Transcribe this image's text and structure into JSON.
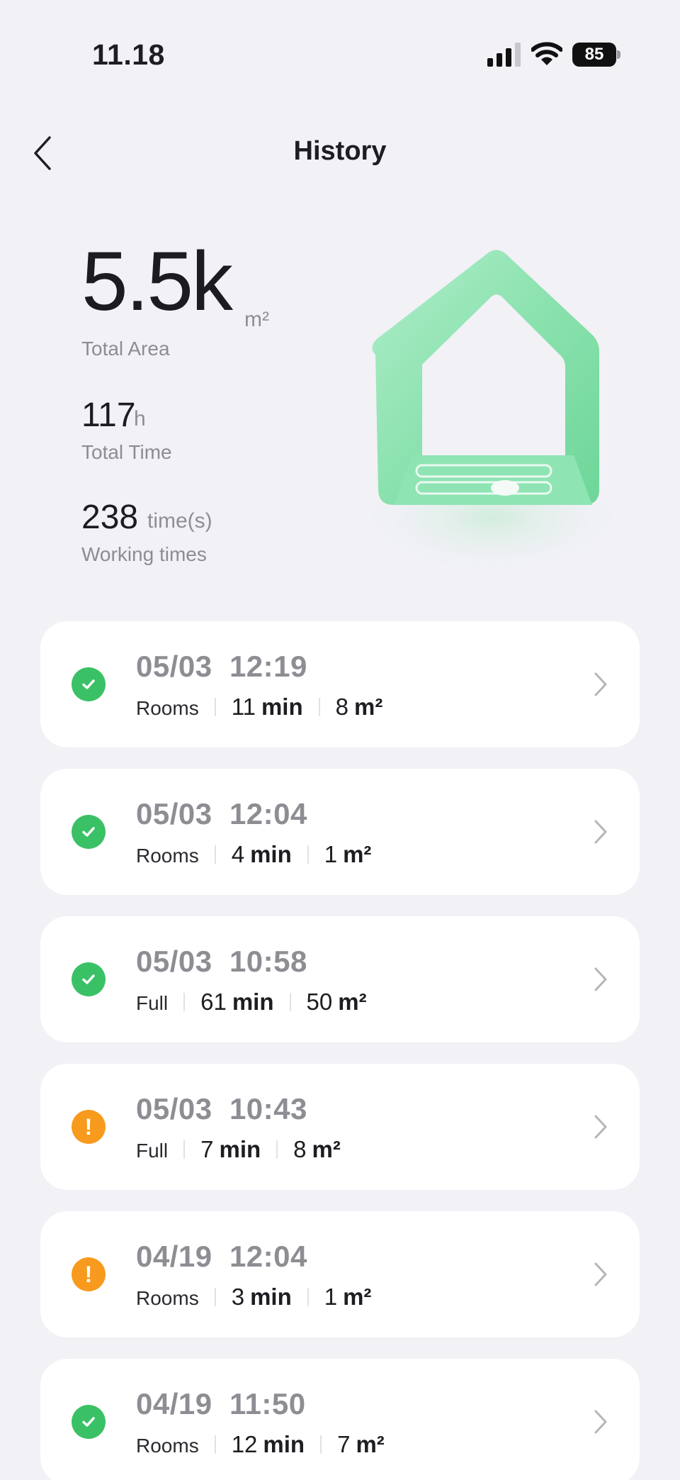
{
  "status_bar": {
    "time": "11.18",
    "battery": "85"
  },
  "header": {
    "title": "History"
  },
  "stats": {
    "total_area": {
      "value": "5.5k",
      "unit": "m²",
      "label": "Total Area"
    },
    "total_time": {
      "value": "117",
      "unit": "h",
      "label": "Total Time"
    },
    "working_times": {
      "value": "238",
      "unit": "time(s)",
      "label": "Working times"
    }
  },
  "records": [
    {
      "status": "success",
      "date": "05/03",
      "time": "12:19",
      "mode": "Rooms",
      "duration": "11",
      "duration_unit": "min",
      "area": "8",
      "area_unit": "m²"
    },
    {
      "status": "success",
      "date": "05/03",
      "time": "12:04",
      "mode": "Rooms",
      "duration": "4",
      "duration_unit": "min",
      "area": "1",
      "area_unit": "m²"
    },
    {
      "status": "success",
      "date": "05/03",
      "time": "10:58",
      "mode": "Full",
      "duration": "61",
      "duration_unit": "min",
      "area": "50",
      "area_unit": "m²"
    },
    {
      "status": "warning",
      "date": "05/03",
      "time": "10:43",
      "mode": "Full",
      "duration": "7",
      "duration_unit": "min",
      "area": "8",
      "area_unit": "m²"
    },
    {
      "status": "warning",
      "date": "04/19",
      "time": "12:04",
      "mode": "Rooms",
      "duration": "3",
      "duration_unit": "min",
      "area": "1",
      "area_unit": "m²"
    },
    {
      "status": "success",
      "date": "04/19",
      "time": "11:50",
      "mode": "Rooms",
      "duration": "12",
      "duration_unit": "min",
      "area": "7",
      "area_unit": "m²"
    }
  ],
  "colors": {
    "success": "#3ac165",
    "warning": "#f79a1e",
    "background": "#f1f1f6",
    "card": "#ffffff"
  },
  "icons": {
    "back": "chevron-left-icon",
    "row": "chevron-right-icon",
    "success": "check-circle-icon",
    "warning": "exclamation-circle-icon"
  }
}
